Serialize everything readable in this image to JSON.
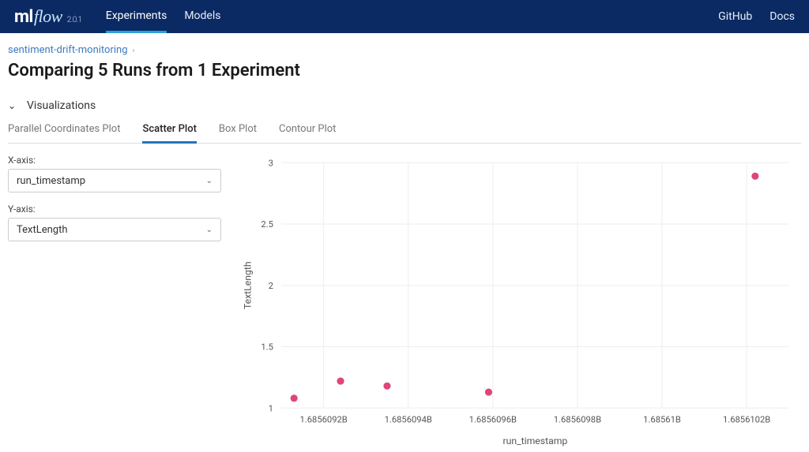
{
  "header": {
    "logo_ml": "ml",
    "logo_flow": "flow",
    "version": "2.0.1",
    "nav": {
      "experiments": "Experiments",
      "models": "Models"
    },
    "right": {
      "github": "GitHub",
      "docs": "Docs"
    }
  },
  "breadcrumb": {
    "root": "sentiment-drift-monitoring"
  },
  "page_title": "Comparing 5 Runs from 1 Experiment",
  "section": {
    "label": "Visualizations"
  },
  "tabs": {
    "parallel": "Parallel Coordinates Plot",
    "scatter": "Scatter Plot",
    "box": "Box Plot",
    "contour": "Contour Plot"
  },
  "controls": {
    "xaxis_label": "X-axis:",
    "xaxis_value": "run_timestamp",
    "yaxis_label": "Y-axis:",
    "yaxis_value": "TextLength"
  },
  "chart_data": {
    "type": "scatter",
    "xlabel": "run_timestamp",
    "ylabel": "TextLength",
    "xlim": [
      1685609100.0,
      1685610300.0
    ],
    "ylim": [
      1,
      3
    ],
    "x_ticks": [
      1685609200.0,
      1685609400.0,
      1685609600.0,
      1685609800.0,
      1685610000.0,
      1685610200.0
    ],
    "x_tick_labels": [
      "1.6856092B",
      "1.6856094B",
      "1.6856096B",
      "1.6856098B",
      "1.68561B",
      "1.6856102B"
    ],
    "y_ticks": [
      1,
      1.5,
      2,
      2.5,
      3
    ],
    "y_tick_labels": [
      "1",
      "1.5",
      "2",
      "2.5",
      "3"
    ],
    "points": [
      {
        "x": 1685609130.0,
        "y": 1.08
      },
      {
        "x": 1685609240.0,
        "y": 1.22
      },
      {
        "x": 1685609350.0,
        "y": 1.18
      },
      {
        "x": 1685609590.0,
        "y": 1.13
      },
      {
        "x": 1685610220.0,
        "y": 2.89
      }
    ]
  }
}
